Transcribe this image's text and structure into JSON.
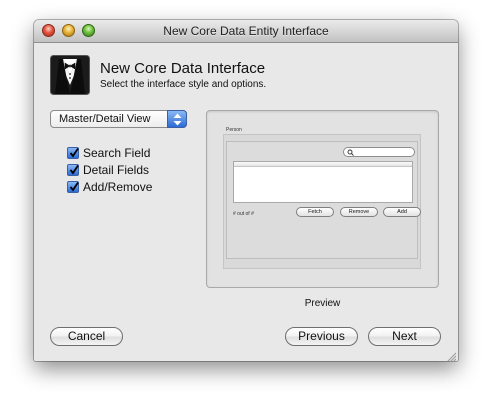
{
  "window": {
    "title": "New Core Data Entity Interface"
  },
  "header": {
    "icon": "tuxedo-icon",
    "title": "New Core Data Interface",
    "subtitle": "Select the interface style and options."
  },
  "style_popup": {
    "selected": "Master/Detail View"
  },
  "options": [
    {
      "label": "Search Field",
      "checked": true
    },
    {
      "label": "Detail Fields",
      "checked": true
    },
    {
      "label": "Add/Remove",
      "checked": true
    }
  ],
  "preview": {
    "caption": "Preview",
    "mini_window": {
      "entity_label": "Person",
      "status_text": "# out of #",
      "buttons": {
        "fetch": "Fetch",
        "remove": "Remove",
        "add": "Add"
      }
    }
  },
  "footer": {
    "cancel_label": "Cancel",
    "previous_label": "Previous",
    "next_label": "Next"
  },
  "colors": {
    "accent_blue": "#2c6bd5",
    "window_bg": "#e8e8e8"
  }
}
